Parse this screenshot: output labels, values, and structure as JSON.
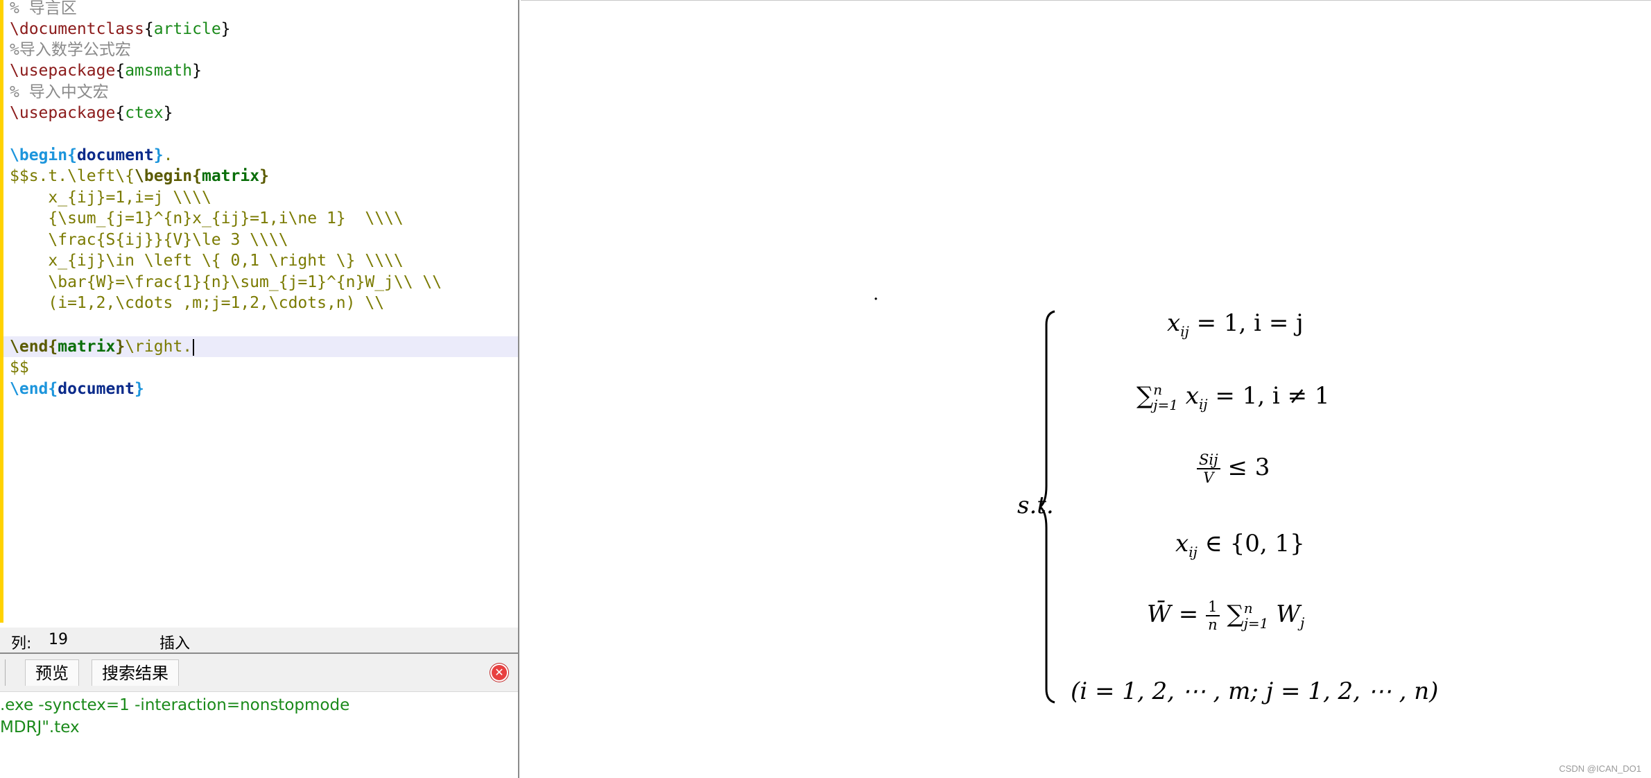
{
  "editor": {
    "lines": {
      "l1": {
        "a": "% 导言区"
      },
      "l2": {
        "a": "\\documentclass",
        "b": "{",
        "c": "article",
        "d": "}"
      },
      "l3": {
        "a": "%导入数学公式宏"
      },
      "l4": {
        "a": "\\usepackage",
        "b": "{",
        "c": "amsmath",
        "d": "}"
      },
      "l5": {
        "a": "% 导入中文宏"
      },
      "l6": {
        "a": "\\usepackage",
        "b": "{",
        "c": "ctex",
        "d": "}"
      },
      "l8": {
        "a": "\\begin",
        "b": "{",
        "c": "document",
        "d": "}",
        "e": "."
      },
      "l9": {
        "a": "$$s.t.\\left\\{",
        "b": "\\begin",
        "c": "{",
        "d": "matrix",
        "e": "}"
      },
      "l10": {
        "a": "    x_{ij}=1,i=j \\\\\\\\"
      },
      "l11": {
        "a": "    {\\sum_{j=1}^{n}x_{ij}=1,i\\ne 1}  \\\\\\\\"
      },
      "l12": {
        "a": "    \\frac{S{ij}}{V}\\le 3 \\\\\\\\"
      },
      "l13": {
        "a": "    x_{ij}\\in \\left \\{ 0,1 \\right \\} \\\\\\\\"
      },
      "l14": {
        "a": "    \\bar{W}=\\frac{1}{n}\\sum_{j=1}^{n}W_j\\\\ \\\\"
      },
      "l15": {
        "a": "    (i=1,2,\\cdots ,m;j=1,2,\\cdots,n) \\\\"
      },
      "l17": {
        "a": "\\end",
        "b": "{",
        "c": "matrix",
        "d": "}",
        "e": "\\right."
      },
      "l18": {
        "a": "$$"
      },
      "l19": {
        "a": "\\end",
        "b": "{",
        "c": "document",
        "d": "}"
      }
    }
  },
  "status": {
    "col_label": "列:",
    "col_value": "19",
    "mode": "插入"
  },
  "bottom_panel": {
    "tabs": {
      "preview": "预览",
      "search": "搜索结果"
    },
    "log": {
      "line1": ".exe -synctex=1 -interaction=nonstopmode",
      "line2": "MDRJ\".tex"
    }
  },
  "preview": {
    "stray_dot": ".",
    "label": "s.t.",
    "row1": {
      "x": "x",
      "sub": "ij",
      "rest": "= 1, i = j"
    },
    "row2": {
      "sum": "∑",
      "sup": "n",
      "sub": "j=1",
      "x": "x",
      "xsub": "ij",
      "rest": "= 1, i ≠ 1"
    },
    "row3": {
      "num": "Sij",
      "den": "V",
      "rest": "≤ 3"
    },
    "row4": {
      "x": "x",
      "sub": "ij",
      "rest": "∈ {0, 1}"
    },
    "row5": {
      "w": "W̄",
      "eq": "=",
      "num": "1",
      "den": "n",
      "sum": "∑",
      "sup": "n",
      "sub": "j=1",
      "w2": "W",
      "w2sub": "j"
    },
    "row6": "(i = 1, 2, ⋯ , m; j = 1, 2, ⋯ , n)"
  },
  "watermark": "CSDN @ICAN_DO1"
}
